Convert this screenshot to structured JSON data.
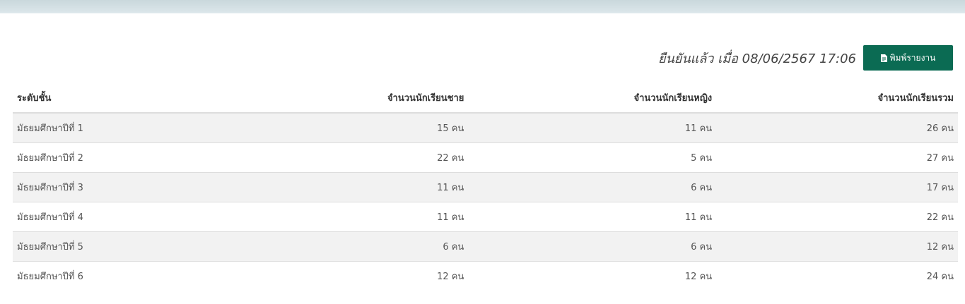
{
  "header": {
    "confirmed_text": "ยืนยันแล้ว เมื่อ 08/06/2567 17:06",
    "print_button_label": "พิมพ์รายงาน",
    "print_icon": "file-pdf-icon"
  },
  "table": {
    "columns": [
      "ระดับชั้น",
      "จำนวนนักเรียนชาย",
      "จำนวนนักเรียนหญิง",
      "จำนวนนักเรียนรวม"
    ],
    "rows": [
      [
        "มัธยมศึกษาปีที่ 1",
        "15 คน",
        "11 คน",
        "26 คน"
      ],
      [
        "มัธยมศึกษาปีที่ 2",
        "22 คน",
        "5 คน",
        "27 คน"
      ],
      [
        "มัธยมศึกษาปีที่ 3",
        "11 คน",
        "6 คน",
        "17 คน"
      ],
      [
        "มัธยมศึกษาปีที่ 4",
        "11 คน",
        "11 คน",
        "22 คน"
      ],
      [
        "มัธยมศึกษาปีที่ 5",
        "6 คน",
        "6 คน",
        "12 คน"
      ],
      [
        "มัธยมศึกษาปีที่ 6",
        "12 คน",
        "12 คน",
        "24 คน"
      ]
    ]
  },
  "colors": {
    "button": "#0b6b53",
    "row_stripe": "#f2f2f2",
    "top_bar": "#d3e0e4"
  }
}
